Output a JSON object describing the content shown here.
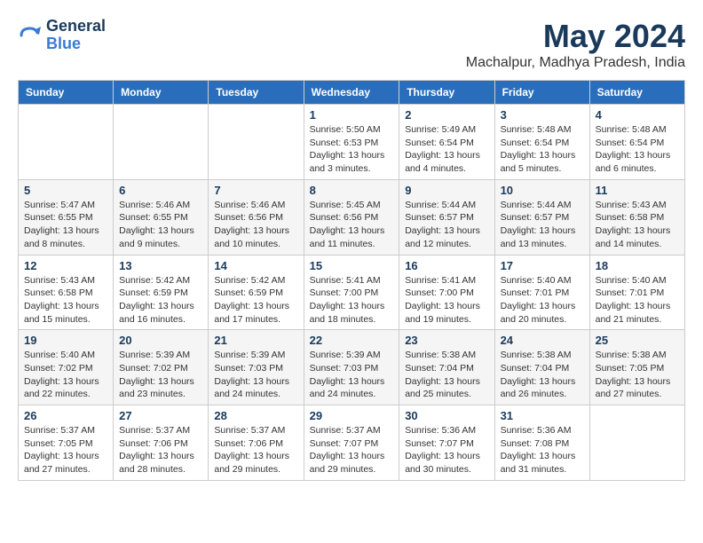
{
  "logo": {
    "general": "General",
    "blue": "Blue"
  },
  "title": "May 2024",
  "subtitle": "Machalpur, Madhya Pradesh, India",
  "headers": [
    "Sunday",
    "Monday",
    "Tuesday",
    "Wednesday",
    "Thursday",
    "Friday",
    "Saturday"
  ],
  "weeks": [
    [
      {
        "day": "",
        "info": ""
      },
      {
        "day": "",
        "info": ""
      },
      {
        "day": "",
        "info": ""
      },
      {
        "day": "1",
        "info": "Sunrise: 5:50 AM\nSunset: 6:53 PM\nDaylight: 13 hours\nand 3 minutes."
      },
      {
        "day": "2",
        "info": "Sunrise: 5:49 AM\nSunset: 6:54 PM\nDaylight: 13 hours\nand 4 minutes."
      },
      {
        "day": "3",
        "info": "Sunrise: 5:48 AM\nSunset: 6:54 PM\nDaylight: 13 hours\nand 5 minutes."
      },
      {
        "day": "4",
        "info": "Sunrise: 5:48 AM\nSunset: 6:54 PM\nDaylight: 13 hours\nand 6 minutes."
      }
    ],
    [
      {
        "day": "5",
        "info": "Sunrise: 5:47 AM\nSunset: 6:55 PM\nDaylight: 13 hours\nand 8 minutes."
      },
      {
        "day": "6",
        "info": "Sunrise: 5:46 AM\nSunset: 6:55 PM\nDaylight: 13 hours\nand 9 minutes."
      },
      {
        "day": "7",
        "info": "Sunrise: 5:46 AM\nSunset: 6:56 PM\nDaylight: 13 hours\nand 10 minutes."
      },
      {
        "day": "8",
        "info": "Sunrise: 5:45 AM\nSunset: 6:56 PM\nDaylight: 13 hours\nand 11 minutes."
      },
      {
        "day": "9",
        "info": "Sunrise: 5:44 AM\nSunset: 6:57 PM\nDaylight: 13 hours\nand 12 minutes."
      },
      {
        "day": "10",
        "info": "Sunrise: 5:44 AM\nSunset: 6:57 PM\nDaylight: 13 hours\nand 13 minutes."
      },
      {
        "day": "11",
        "info": "Sunrise: 5:43 AM\nSunset: 6:58 PM\nDaylight: 13 hours\nand 14 minutes."
      }
    ],
    [
      {
        "day": "12",
        "info": "Sunrise: 5:43 AM\nSunset: 6:58 PM\nDaylight: 13 hours\nand 15 minutes."
      },
      {
        "day": "13",
        "info": "Sunrise: 5:42 AM\nSunset: 6:59 PM\nDaylight: 13 hours\nand 16 minutes."
      },
      {
        "day": "14",
        "info": "Sunrise: 5:42 AM\nSunset: 6:59 PM\nDaylight: 13 hours\nand 17 minutes."
      },
      {
        "day": "15",
        "info": "Sunrise: 5:41 AM\nSunset: 7:00 PM\nDaylight: 13 hours\nand 18 minutes."
      },
      {
        "day": "16",
        "info": "Sunrise: 5:41 AM\nSunset: 7:00 PM\nDaylight: 13 hours\nand 19 minutes."
      },
      {
        "day": "17",
        "info": "Sunrise: 5:40 AM\nSunset: 7:01 PM\nDaylight: 13 hours\nand 20 minutes."
      },
      {
        "day": "18",
        "info": "Sunrise: 5:40 AM\nSunset: 7:01 PM\nDaylight: 13 hours\nand 21 minutes."
      }
    ],
    [
      {
        "day": "19",
        "info": "Sunrise: 5:40 AM\nSunset: 7:02 PM\nDaylight: 13 hours\nand 22 minutes."
      },
      {
        "day": "20",
        "info": "Sunrise: 5:39 AM\nSunset: 7:02 PM\nDaylight: 13 hours\nand 23 minutes."
      },
      {
        "day": "21",
        "info": "Sunrise: 5:39 AM\nSunset: 7:03 PM\nDaylight: 13 hours\nand 24 minutes."
      },
      {
        "day": "22",
        "info": "Sunrise: 5:39 AM\nSunset: 7:03 PM\nDaylight: 13 hours\nand 24 minutes."
      },
      {
        "day": "23",
        "info": "Sunrise: 5:38 AM\nSunset: 7:04 PM\nDaylight: 13 hours\nand 25 minutes."
      },
      {
        "day": "24",
        "info": "Sunrise: 5:38 AM\nSunset: 7:04 PM\nDaylight: 13 hours\nand 26 minutes."
      },
      {
        "day": "25",
        "info": "Sunrise: 5:38 AM\nSunset: 7:05 PM\nDaylight: 13 hours\nand 27 minutes."
      }
    ],
    [
      {
        "day": "26",
        "info": "Sunrise: 5:37 AM\nSunset: 7:05 PM\nDaylight: 13 hours\nand 27 minutes."
      },
      {
        "day": "27",
        "info": "Sunrise: 5:37 AM\nSunset: 7:06 PM\nDaylight: 13 hours\nand 28 minutes."
      },
      {
        "day": "28",
        "info": "Sunrise: 5:37 AM\nSunset: 7:06 PM\nDaylight: 13 hours\nand 29 minutes."
      },
      {
        "day": "29",
        "info": "Sunrise: 5:37 AM\nSunset: 7:07 PM\nDaylight: 13 hours\nand 29 minutes."
      },
      {
        "day": "30",
        "info": "Sunrise: 5:36 AM\nSunset: 7:07 PM\nDaylight: 13 hours\nand 30 minutes."
      },
      {
        "day": "31",
        "info": "Sunrise: 5:36 AM\nSunset: 7:08 PM\nDaylight: 13 hours\nand 31 minutes."
      },
      {
        "day": "",
        "info": ""
      }
    ]
  ]
}
